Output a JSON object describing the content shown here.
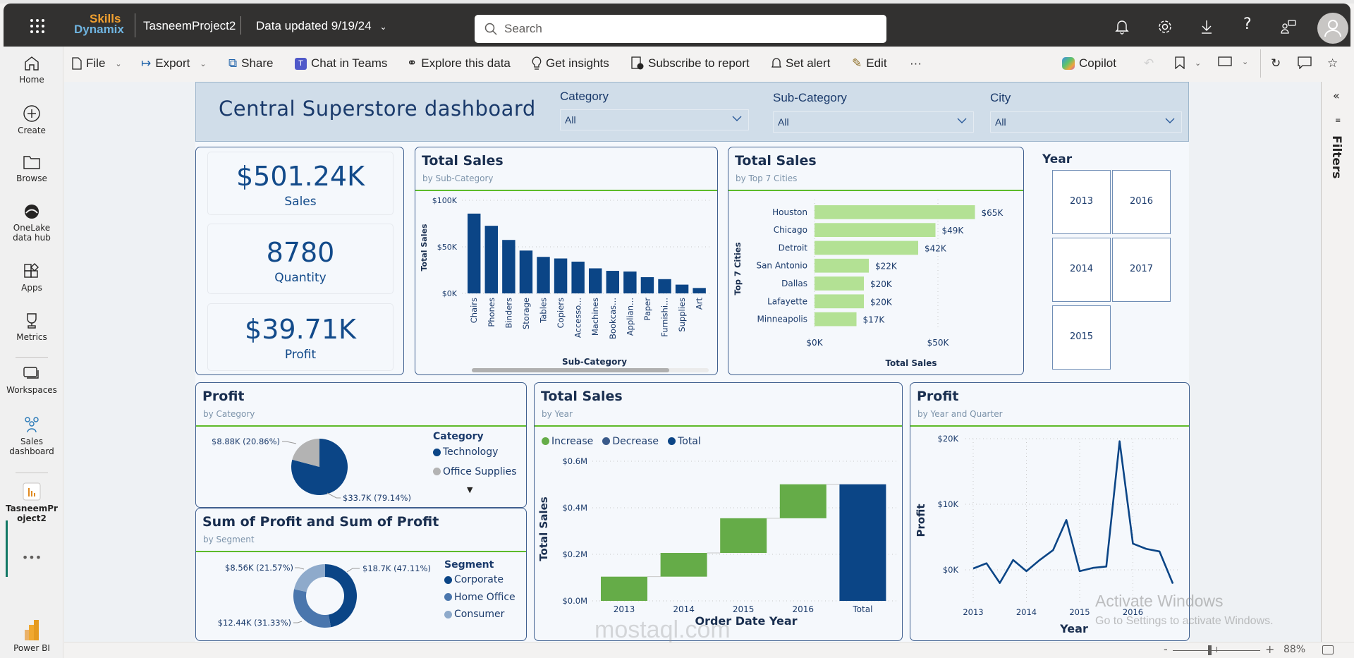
{
  "topbar": {
    "brand_line1": "Skills",
    "brand_line2": "Dynamix",
    "workspace": "TasneemProject2",
    "data_updated": "Data updated 9/19/24",
    "search_placeholder": "Search",
    "icons": [
      "notifications-icon",
      "settings-icon",
      "download-icon",
      "help-icon",
      "feedback-icon",
      "account-icon"
    ]
  },
  "toolbar": {
    "file": "File",
    "export": "Export",
    "share": "Share",
    "chat_in_teams": "Chat in Teams",
    "explore": "Explore this data",
    "insights": "Get insights",
    "subscribe": "Subscribe to report",
    "set_alert": "Set alert",
    "edit": "Edit",
    "more": "···",
    "copilot": "Copilot"
  },
  "leftnav": {
    "items": [
      {
        "label": "Home"
      },
      {
        "label": "Create"
      },
      {
        "label": "Browse"
      },
      {
        "label": "OneLake data hub"
      },
      {
        "label": "Apps"
      },
      {
        "label": "Metrics"
      },
      {
        "label": "Workspaces"
      },
      {
        "label": "Sales dashboard"
      },
      {
        "label": "TasneemProject2"
      }
    ],
    "more": "•••",
    "footer": "Power BI"
  },
  "report": {
    "title": "Central Superstore dashboard",
    "slicers": [
      {
        "label": "Category",
        "value": "All"
      },
      {
        "label": "Sub-Category",
        "value": "All"
      },
      {
        "label": "City",
        "value": "All"
      }
    ],
    "kpis": [
      {
        "value": "$501.24K",
        "label": "Sales"
      },
      {
        "value": "8780",
        "label": "Quantity"
      },
      {
        "value": "$39.71K",
        "label": "Profit"
      }
    ],
    "year_slicer": {
      "label": "Year",
      "options": [
        "2013",
        "2016",
        "2014",
        "2017",
        "2015"
      ]
    }
  },
  "filters_pane": {
    "label": "Filters"
  },
  "statusbar": {
    "zoom": "88%",
    "zoom_minus": "-",
    "zoom_plus": "+",
    "zoom_fraction": 0.42
  },
  "watermarks": {
    "activate_title": "Activate Windows",
    "activate_sub": "Go to Settings to activate Windows.",
    "mostaql": "mostaql.com"
  },
  "colors": {
    "navy": "#0b4586",
    "green_bar": "#b3e194",
    "waterfall_green": "#65ac48",
    "accent_rule": "#5dbb2a",
    "gray_slice": "#b3b3b3",
    "home_office": "#4a76ad",
    "consumer": "#8eaacb"
  },
  "chart_data": [
    {
      "id": "sales_by_subcategory",
      "type": "bar",
      "title": "Total Sales",
      "subtitle": "by Sub-Category",
      "xlabel": "Sub-Category",
      "ylabel": "Total Sales",
      "categories": [
        "Chairs",
        "Phones",
        "Binders",
        "Storage",
        "Tables",
        "Copiers",
        "Accesso...",
        "Machines",
        "Bookcas...",
        "Applian...",
        "Paper",
        "Furnishi...",
        "Supplies",
        "Art"
      ],
      "values": [
        85.7,
        72.6,
        57.4,
        46.0,
        39.2,
        37.5,
        34.1,
        26.9,
        24.2,
        23.5,
        17.4,
        15.3,
        9.4,
        5.8
      ],
      "unit": "K$",
      "ylim": [
        0,
        100
      ],
      "yticks": [
        "$0K",
        "$50K",
        "$100K"
      ],
      "ytick_values": [
        0,
        50,
        100
      ],
      "grid": true
    },
    {
      "id": "sales_by_city",
      "type": "bar",
      "orientation": "horizontal",
      "title": "Total Sales",
      "subtitle": "by Top 7 Cities",
      "xlabel": "Total Sales",
      "ylabel": "Top 7 Cities",
      "categories": [
        "Houston",
        "Chicago",
        "Detroit",
        "San Antonio",
        "Dallas",
        "Lafayette",
        "Minneapolis"
      ],
      "values": [
        65,
        49,
        42,
        22,
        20,
        20,
        17
      ],
      "data_labels": [
        "$65K",
        "$49K",
        "$42K",
        "$22K",
        "$20K",
        "$20K",
        "$17K"
      ],
      "xlim": [
        0,
        70
      ],
      "xticks": [
        "$0K",
        "$50K"
      ],
      "xtick_values": [
        0,
        50
      ],
      "grid": true
    },
    {
      "id": "profit_by_category",
      "type": "pie",
      "title": "Profit",
      "subtitle": "by Category",
      "legend_title": "Category",
      "labels": [
        "Technology",
        "Office Supplies"
      ],
      "values": [
        33.7,
        8.88
      ],
      "percent": [
        79.14,
        20.86
      ],
      "data_labels": [
        "$33.7K (79.14%)",
        "$8.88K (20.86%)"
      ],
      "legend": "right"
    },
    {
      "id": "profit_by_segment",
      "type": "pie",
      "donut": true,
      "title": "Sum of Profit and Sum of Profit",
      "subtitle": "by Segment",
      "legend_title": "Segment",
      "labels": [
        "Corporate",
        "Home Office",
        "Consumer"
      ],
      "values": [
        18.7,
        12.44,
        8.56
      ],
      "percent": [
        47.11,
        31.33,
        21.57
      ],
      "data_labels": [
        "$18.7K (47.11%)",
        "$12.44K (31.33%)",
        "$8.56K (21.57%)"
      ],
      "legend": "right"
    },
    {
      "id": "sales_by_year_waterfall",
      "type": "bar",
      "subtype": "waterfall",
      "title": "Total Sales",
      "subtitle": "by Year",
      "xlabel": "Order Date Year",
      "ylabel": "Total Sales",
      "legend": [
        "Increase",
        "Decrease",
        "Total"
      ],
      "categories": [
        "2013",
        "2014",
        "2015",
        "2016",
        "Total"
      ],
      "increments": [
        0.104,
        0.102,
        0.149,
        0.146
      ],
      "total": 0.501,
      "unit": "M$",
      "ylim": [
        0,
        0.6
      ],
      "yticks": [
        "$0.0M",
        "$0.2M",
        "$0.4M",
        "$0.6M"
      ],
      "ytick_values": [
        0,
        0.2,
        0.4,
        0.6
      ],
      "grid": true
    },
    {
      "id": "profit_by_year_quarter",
      "type": "line",
      "title": "Profit",
      "subtitle": "by Year and Quarter",
      "xlabel": "Year",
      "ylabel": "Profit",
      "x": [
        "2013 Q1",
        "2013 Q2",
        "2013 Q3",
        "2013 Q4",
        "2014 Q1",
        "2014 Q2",
        "2014 Q3",
        "2014 Q4",
        "2015 Q1",
        "2015 Q2",
        "2015 Q3",
        "2015 Q4",
        "2016 Q1",
        "2016 Q2",
        "2016 Q3",
        "2016 Q4"
      ],
      "values": [
        0.2,
        1.0,
        -2.0,
        1.5,
        -0.2,
        1.5,
        3.0,
        7.6,
        -0.2,
        0.3,
        0.5,
        19.6,
        4.0,
        3.2,
        2.8,
        -2.1
      ],
      "unit": "K$",
      "ylim": [
        -3.5,
        20
      ],
      "yticks": [
        "$0K",
        "$10K",
        "$20K"
      ],
      "ytick_values": [
        0,
        10,
        20
      ],
      "xticks": [
        "2013",
        "2014",
        "2015",
        "2016"
      ],
      "grid": true
    }
  ]
}
